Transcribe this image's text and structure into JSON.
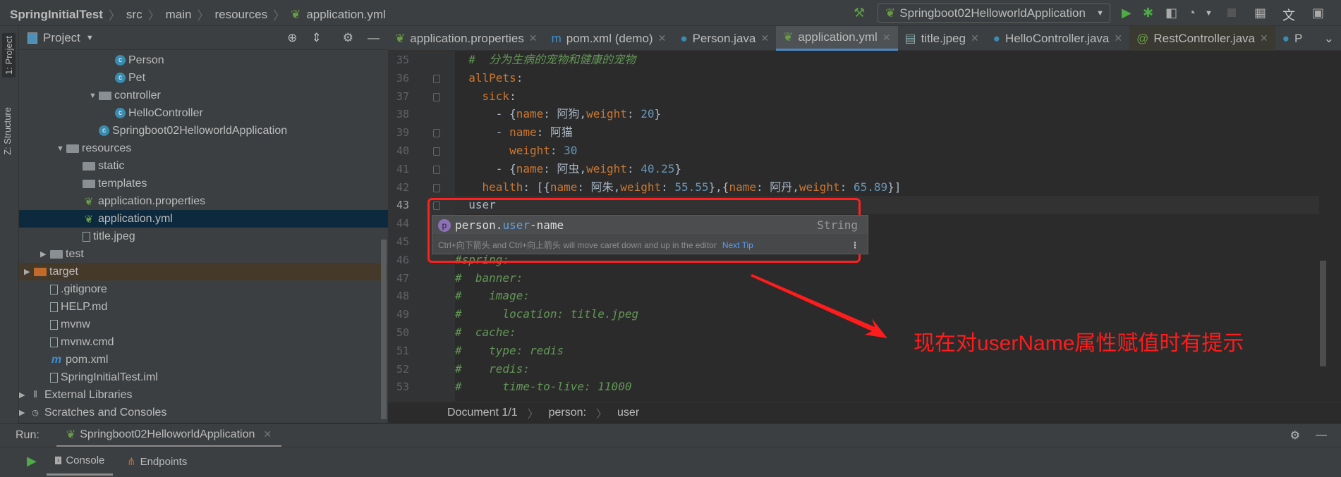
{
  "breadcrumb": [
    "SpringInitialTest",
    "src",
    "main",
    "resources",
    "application.yml"
  ],
  "toolbar": {
    "run_config": "Springboot02HelloworldApplication",
    "icons": [
      "hammer-icon",
      "run-icon",
      "debug-icon",
      "coverage-icon",
      "profile-icon",
      "stop-icon",
      "project-structure-icon",
      "translate-icon",
      "terminal-icon"
    ]
  },
  "left_strip": {
    "project": "1: Project",
    "structure": "Z: Structure"
  },
  "project_panel": {
    "title": "Project"
  },
  "tree": [
    {
      "label": "Person",
      "indent": 4,
      "icon": "class",
      "arrow": ""
    },
    {
      "label": "Pet",
      "indent": 4,
      "icon": "class",
      "arrow": ""
    },
    {
      "label": "controller",
      "indent": 3,
      "icon": "package",
      "arrow": "down"
    },
    {
      "label": "HelloController",
      "indent": 4,
      "icon": "class",
      "arrow": ""
    },
    {
      "label": "Springboot02HelloworldApplication",
      "indent": 3,
      "icon": "spring-class",
      "arrow": ""
    },
    {
      "label": "resources",
      "indent": 1,
      "icon": "folder",
      "arrow": "down"
    },
    {
      "label": "static",
      "indent": 2,
      "icon": "folder",
      "arrow": ""
    },
    {
      "label": "templates",
      "indent": 2,
      "icon": "folder",
      "arrow": ""
    },
    {
      "label": "application.properties",
      "indent": 2,
      "icon": "spring",
      "arrow": ""
    },
    {
      "label": "application.yml",
      "indent": 2,
      "icon": "spring",
      "arrow": "",
      "selected": true
    },
    {
      "label": "title.jpeg",
      "indent": 2,
      "icon": "image",
      "arrow": ""
    },
    {
      "label": "test",
      "indent": 0,
      "icon": "folder",
      "arrow": "right"
    },
    {
      "label": "target",
      "indent": -1,
      "icon": "folder-orange",
      "arrow": "right",
      "highlight": true
    },
    {
      "label": ".gitignore",
      "indent": 0,
      "icon": "file",
      "arrow": ""
    },
    {
      "label": "HELP.md",
      "indent": 0,
      "icon": "md",
      "arrow": ""
    },
    {
      "label": "mvnw",
      "indent": 0,
      "icon": "file",
      "arrow": ""
    },
    {
      "label": "mvnw.cmd",
      "indent": 0,
      "icon": "file",
      "arrow": ""
    },
    {
      "label": "pom.xml",
      "indent": 0,
      "icon": "maven",
      "arrow": ""
    },
    {
      "label": "SpringInitialTest.iml",
      "indent": 0,
      "icon": "file",
      "arrow": ""
    },
    {
      "label": "External Libraries",
      "indent": -2,
      "icon": "libraries",
      "arrow": "right"
    },
    {
      "label": "Scratches and Consoles",
      "indent": -2,
      "icon": "scratches",
      "arrow": "right"
    }
  ],
  "tabs": [
    {
      "label": "application.properties",
      "icon": "spring"
    },
    {
      "label": "pom.xml (demo)",
      "icon": "maven"
    },
    {
      "label": "Person.java",
      "icon": "class"
    },
    {
      "label": "application.yml",
      "icon": "spring",
      "active": true
    },
    {
      "label": "title.jpeg",
      "icon": "image"
    },
    {
      "label": "HelloController.java",
      "icon": "class"
    },
    {
      "label": "RestController.java",
      "icon": "annotation",
      "dim": true
    },
    {
      "label": "P",
      "icon": "class"
    }
  ],
  "editor": {
    "current_line": 43,
    "lines": [
      {
        "n": 35,
        "seg": [
          [
            "c",
            "  #  分为生病的宠物和健康的宠物"
          ]
        ]
      },
      {
        "n": 36,
        "fold": true,
        "seg": [
          [
            "k",
            "  allPets"
          ],
          [
            "t",
            ":"
          ]
        ]
      },
      {
        "n": 37,
        "fold": true,
        "seg": [
          [
            "k",
            "    sick"
          ],
          [
            "t",
            ":"
          ]
        ]
      },
      {
        "n": 38,
        "seg": [
          [
            "t",
            "      - {"
          ],
          [
            "k",
            "name"
          ],
          [
            "t",
            ": 阿狗,"
          ],
          [
            "k",
            "weight"
          ],
          [
            "t",
            ": "
          ],
          [
            "n",
            "20"
          ],
          [
            "t",
            "}"
          ]
        ]
      },
      {
        "n": 39,
        "fold": true,
        "seg": [
          [
            "t",
            "      - "
          ],
          [
            "k",
            "name"
          ],
          [
            "t",
            ": 阿猫"
          ]
        ]
      },
      {
        "n": 40,
        "fold": true,
        "seg": [
          [
            "k",
            "        weight"
          ],
          [
            "t",
            ": "
          ],
          [
            "n",
            "30"
          ]
        ]
      },
      {
        "n": 41,
        "fold": true,
        "seg": [
          [
            "t",
            "      - {"
          ],
          [
            "k",
            "name"
          ],
          [
            "t",
            ": 阿虫,"
          ],
          [
            "k",
            "weight"
          ],
          [
            "t",
            ": "
          ],
          [
            "n",
            "40.25"
          ],
          [
            "t",
            "}"
          ]
        ]
      },
      {
        "n": 42,
        "fold": true,
        "seg": [
          [
            "k",
            "    health"
          ],
          [
            "t",
            ": [{"
          ],
          [
            "k",
            "name"
          ],
          [
            "t",
            ": 阿朱,"
          ],
          [
            "k",
            "weight"
          ],
          [
            "t",
            ": "
          ],
          [
            "n",
            "55.55"
          ],
          [
            "t",
            "},{"
          ],
          [
            "k",
            "name"
          ],
          [
            "t",
            ": 阿丹,"
          ],
          [
            "k",
            "weight"
          ],
          [
            "t",
            ": "
          ],
          [
            "n",
            "65.89"
          ],
          [
            "t",
            "}]"
          ]
        ]
      },
      {
        "n": 43,
        "fold": true,
        "seg": [
          [
            "t",
            "  user"
          ]
        ]
      },
      {
        "n": 44,
        "seg": []
      },
      {
        "n": 45,
        "seg": []
      },
      {
        "n": 46,
        "seg": [
          [
            "c",
            "#spring:"
          ]
        ]
      },
      {
        "n": 47,
        "seg": [
          [
            "c",
            "#  banner:"
          ]
        ]
      },
      {
        "n": 48,
        "seg": [
          [
            "c",
            "#    image:"
          ]
        ]
      },
      {
        "n": 49,
        "seg": [
          [
            "c",
            "#      location: title.jpeg"
          ]
        ]
      },
      {
        "n": 50,
        "seg": [
          [
            "c",
            "#  cache:"
          ]
        ]
      },
      {
        "n": 51,
        "seg": [
          [
            "c",
            "#    type: redis"
          ]
        ]
      },
      {
        "n": 52,
        "seg": [
          [
            "c",
            "#    redis:"
          ]
        ]
      },
      {
        "n": 53,
        "seg": [
          [
            "c",
            "#      time-to-live: 11000"
          ]
        ]
      }
    ]
  },
  "completion": {
    "icon_letter": "p",
    "prefix": "person.",
    "match": "user",
    "suffix": "-name",
    "type": "String",
    "tip": "Ctrl+向下箭头 and Ctrl+向上箭头 will move caret down and up in the editor",
    "next_tip": "Next Tip"
  },
  "doc_breadcrumb": [
    "Document 1/1",
    "person:",
    "user"
  ],
  "run": {
    "label": "Run:",
    "tab": "Springboot02HelloworldApplication",
    "console": "Console",
    "endpoints": "Endpoints"
  },
  "annotation": {
    "text": "现在对userName属性赋值时有提示",
    "color": "#ff1c1c"
  },
  "colors": {
    "key": "#cc7832",
    "number": "#6897bb",
    "comment": "#629755",
    "selection": "#0d293e",
    "accent": "#4a88c7"
  }
}
